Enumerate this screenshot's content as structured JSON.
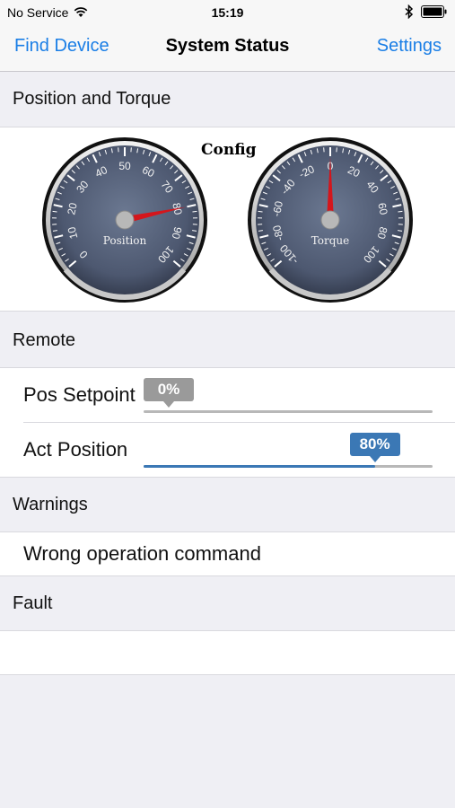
{
  "status_bar": {
    "carrier": "No Service",
    "time": "15:19",
    "icons": [
      "wifi-icon",
      "bluetooth-icon",
      "battery-icon"
    ]
  },
  "nav": {
    "left": "Find Device",
    "title": "System Status",
    "right": "Settings",
    "accent_color": "#1a7ee6"
  },
  "sections": {
    "position_torque": "Position and Torque",
    "remote": "Remote",
    "warnings": "Warnings",
    "fault": "Fault"
  },
  "gauges": {
    "config_label": "Config",
    "position": {
      "label": "Position",
      "ticks": [
        "0",
        "10",
        "20",
        "30",
        "40",
        "50",
        "60",
        "70",
        "80",
        "90",
        "100"
      ],
      "value": 80
    },
    "torque": {
      "label": "Torque",
      "ticks": [
        "-100",
        "-80",
        "-60",
        "-40",
        "-20",
        "0",
        "20",
        "40",
        "60",
        "80",
        "100"
      ],
      "value": 0
    }
  },
  "remote": {
    "pos_setpoint": {
      "label": "Pos Setpoint",
      "value_text": "0%",
      "fraction": 0.0
    },
    "act_position": {
      "label": "Act Position",
      "value_text": "80%",
      "fraction": 0.8
    }
  },
  "warnings": {
    "message": "Wrong operation command"
  },
  "fault": {
    "message": ""
  }
}
